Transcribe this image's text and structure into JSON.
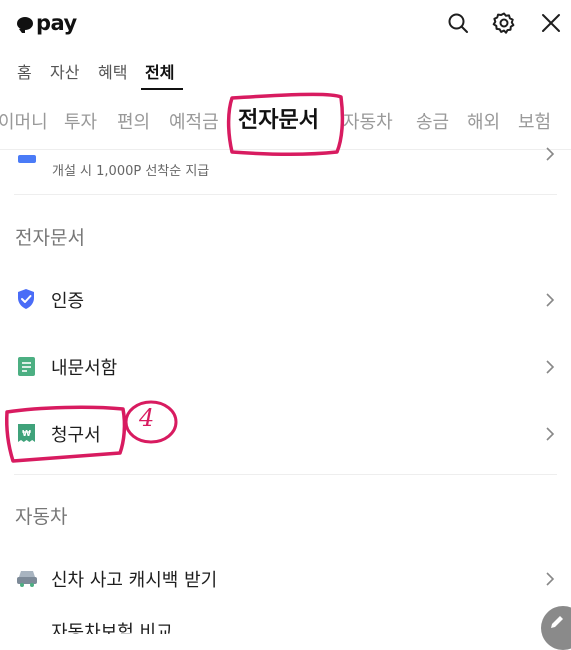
{
  "header": {
    "logo_text": "pay",
    "icons": [
      "search-icon",
      "gear-icon",
      "close-icon"
    ]
  },
  "main_tabs": [
    "홈",
    "자산",
    "혜택",
    "전체"
  ],
  "categories": [
    "이머니",
    "투자",
    "편의",
    "예적금",
    "전자문서",
    "자동차",
    "송금",
    "해외",
    "보험"
  ],
  "promo_subtext": "개설 시 1,000P 선착순 지급",
  "sections": {
    "documents": {
      "title": "전자문서",
      "items": [
        "인증",
        "내문서함",
        "청구서"
      ]
    },
    "car": {
      "title": "자동차",
      "items": [
        "신차 사고 캐시백 받기",
        "자동차보험 비교"
      ]
    }
  },
  "annotation": {
    "step_number": "4",
    "color": "#d81b60"
  }
}
